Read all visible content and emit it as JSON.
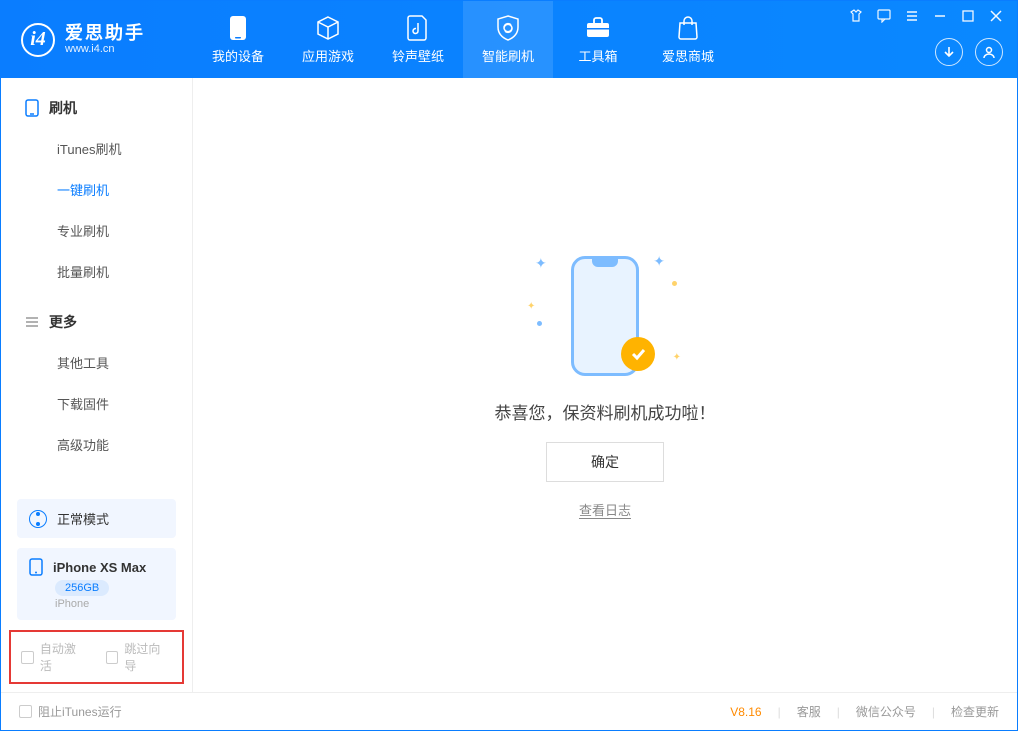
{
  "app": {
    "name_cn": "爱思助手",
    "name_en": "www.i4.cn"
  },
  "tabs": {
    "device": "我的设备",
    "apps": "应用游戏",
    "ring": "铃声壁纸",
    "flash": "智能刷机",
    "tools": "工具箱",
    "store": "爱思商城"
  },
  "sidebar": {
    "flash_header": "刷机",
    "items": {
      "itunes": "iTunes刷机",
      "oneclick": "一键刷机",
      "pro": "专业刷机",
      "batch": "批量刷机"
    },
    "more_header": "更多",
    "more": {
      "other": "其他工具",
      "firmware": "下载固件",
      "adv": "高级功能"
    }
  },
  "mode": {
    "label": "正常模式"
  },
  "device": {
    "name": "iPhone XS Max",
    "storage": "256GB",
    "type": "iPhone"
  },
  "options": {
    "auto_activate": "自动激活",
    "skip_guide": "跳过向导"
  },
  "main": {
    "message": "恭喜您，保资料刷机成功啦！",
    "ok": "确定",
    "view_log": "查看日志"
  },
  "footer": {
    "block_itunes": "阻止iTunes运行",
    "version": "V8.16",
    "support": "客服",
    "wechat": "微信公众号",
    "update": "检查更新"
  }
}
